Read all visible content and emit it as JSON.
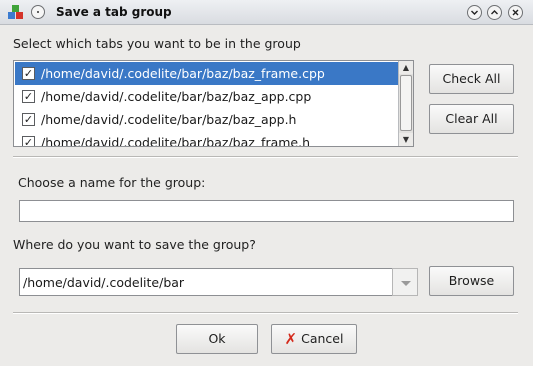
{
  "window": {
    "title": "Save a tab group",
    "app_icon": "codelite-app-icon",
    "controls": {
      "minimize": "⊙",
      "maximize": "⊙",
      "close": "⊗"
    }
  },
  "tabs_prompt": "Select which tabs you want to be in the group",
  "tabs": [
    {
      "label": "/home/david/.codelite/bar/baz/baz_frame.cpp",
      "checked": true,
      "selected": true
    },
    {
      "label": "/home/david/.codelite/bar/baz/baz_app.cpp",
      "checked": true,
      "selected": false
    },
    {
      "label": "/home/david/.codelite/bar/baz/baz_app.h",
      "checked": true,
      "selected": false
    },
    {
      "label": "/home/david/.codelite/bar/baz/baz_frame.h",
      "checked": true,
      "selected": false
    }
  ],
  "check_mark": "✓",
  "buttons": {
    "check_all": "Check All",
    "clear_all": "Clear All",
    "browse": "Browse",
    "ok": "Ok",
    "cancel": "Cancel"
  },
  "name_prompt": "Choose a name for the group:",
  "name_value": "",
  "path_prompt": "Where do you want to save the group?",
  "path_value": "/home/david/.codelite/bar",
  "colors": {
    "selection": "#3a78c6",
    "cancel_icon": "#d42a1c"
  }
}
